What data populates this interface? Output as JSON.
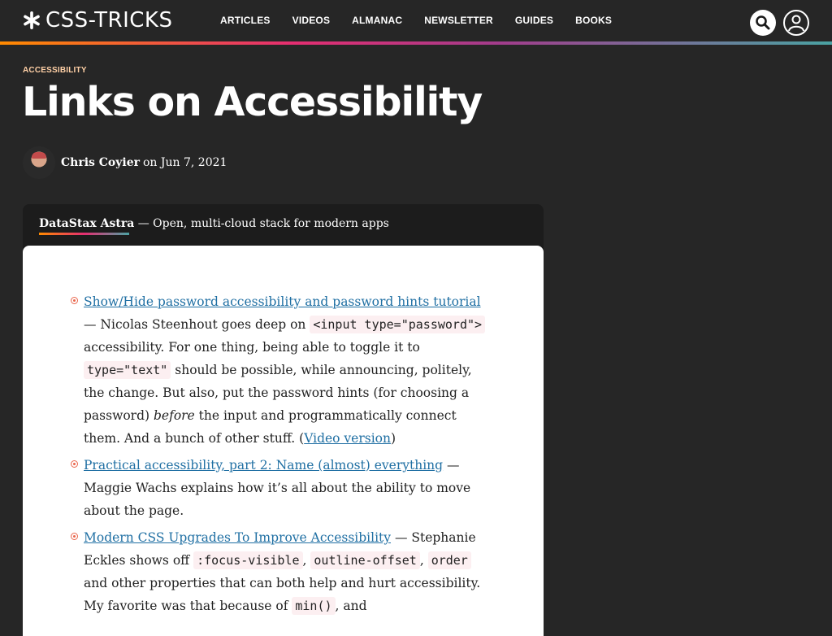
{
  "header": {
    "logo_text": "CSS-TRICKS",
    "nav": [
      "ARTICLES",
      "VIDEOS",
      "ALMANAC",
      "NEWSLETTER",
      "GUIDES",
      "BOOKS"
    ]
  },
  "article": {
    "category": "ACCESSIBILITY",
    "title": "Links on Accessibility",
    "author": "Chris Coyier",
    "date_prefix": "on",
    "date": "Jun 7, 2021"
  },
  "sponsor": {
    "name": "DataStax Astra",
    "text": " — Open, multi-cloud stack for modern apps"
  },
  "items": [
    {
      "link": "Show/Hide password accessibility and password hints tutorial",
      "t1": " — Nicolas Steenhout goes deep on ",
      "c1": "<input type=\"password\">",
      "t2": " accessibility. For one thing, being able to toggle it to ",
      "c2": "type=\"text\"",
      "t3": " should be possible, while announcing, politely, the change. But also, put the password hints (for choosing a password) ",
      "em": "before",
      "t4": " the input and programmatically connect them. And a bunch of other stuff. (",
      "link2": "Video version",
      "t5": ")"
    },
    {
      "link": "Practical accessibility, part 2: Name (almost) everything",
      "t1": " — Maggie Wachs explains how it’s all about the ability to move about the page."
    },
    {
      "link": "Modern CSS Upgrades To Improve Accessibility",
      "t1": " — Stephanie Eckles shows off ",
      "c1": ":focus-visible",
      "t2": ", ",
      "c2": "outline-offset",
      "t3": ", ",
      "c3": "order",
      "t4": " and other properties that can both help and hurt accessibility. My favorite was that because of ",
      "c4": "min()",
      "t5": ", and"
    }
  ],
  "colors": {
    "background": "#262626",
    "accent_link": "#1f6fa3",
    "bullet": "#e9654b",
    "category": "#ffd0a6"
  },
  "icons": [
    "asterisk-logo-icon",
    "search-icon",
    "user-icon"
  ]
}
